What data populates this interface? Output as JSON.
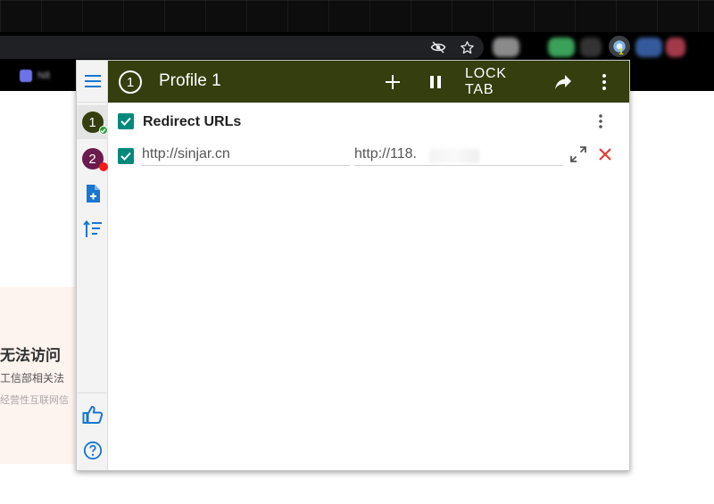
{
  "browser": {
    "extension_badge": "1",
    "bookmark_label": "N8",
    "icons": [
      "hide-eye-icon",
      "star-icon"
    ]
  },
  "page": {
    "heading": "无法访问",
    "line1": "工信部相关法",
    "line2": "经营性互联网信"
  },
  "popup": {
    "colors": {
      "header": "#343e0f",
      "accent": "#00897b",
      "delete": "#e53935",
      "sidebar_icon": "#1976d2"
    },
    "sidebar": {
      "profiles": [
        {
          "number": "1",
          "color": "#343e0f",
          "status": "active-green"
        },
        {
          "number": "2",
          "color": "#6b1b4d",
          "status": "inactive-red"
        }
      ],
      "icons": [
        "menu-icon",
        "add-file-icon",
        "sort-icon",
        "thumbs-up-icon",
        "help-icon"
      ]
    },
    "header": {
      "profile_number": "1",
      "title": "Profile 1",
      "lock_tab_label": "LOCK TAB"
    },
    "group": {
      "title": "Redirect URLs",
      "checked": true
    },
    "rule": {
      "checked": true,
      "from_url": "http://sinjar.cn",
      "to_url": "http://118."
    }
  }
}
